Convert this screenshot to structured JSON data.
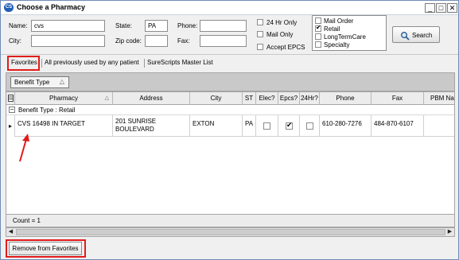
{
  "window": {
    "title": "Choose a Pharmacy",
    "icon_text": "CS",
    "minimize": "_",
    "maximize": "□",
    "close": "✕"
  },
  "search": {
    "name_label": "Name:",
    "name_value": "cvs",
    "city_label": "City:",
    "city_value": "",
    "state_label": "State:",
    "state_value": "PA",
    "zip_label": "Zip code:",
    "zip_value": "",
    "phone_label": "Phone:",
    "phone_value": "",
    "fax_label": "Fax:",
    "fax_value": "",
    "options": [
      {
        "label": "24 Hr Only",
        "checked": false
      },
      {
        "label": "Mail Only",
        "checked": false
      },
      {
        "label": "Accept EPCS",
        "checked": false
      }
    ],
    "types": [
      {
        "label": "Mail Order",
        "checked": false
      },
      {
        "label": "Retail",
        "checked": true
      },
      {
        "label": "LongTermCare",
        "checked": false
      },
      {
        "label": "Specialty",
        "checked": false
      }
    ],
    "search_button": "Search"
  },
  "tabs": [
    "Favorites",
    "All previously used by any patient",
    "SureScripts Master List"
  ],
  "groupby": {
    "chip": "Benefit Type"
  },
  "grid": {
    "columns": [
      "Pharmacy",
      "Address",
      "City",
      "ST",
      "Elec?",
      "Epcs?",
      "24Hr?",
      "Phone",
      "Fax",
      "PBM Nam"
    ],
    "group_label": "Benefit Type : Retail",
    "rows": [
      {
        "pharmacy": "CVS 16498 IN TARGET",
        "address_1": "201 SUNRISE",
        "address_2": "BOULEVARD",
        "city": "EXTON",
        "st": "PA",
        "elec": false,
        "epcs": true,
        "hr24": false,
        "phone": "610-280-7276",
        "fax": "484-870-6107",
        "pbm": ""
      }
    ]
  },
  "count_text": "Count = 1",
  "remove_button": "Remove from Favorites",
  "colors": {
    "highlight": "#e11b1b",
    "titlebar_icon": "#1f5fb4"
  }
}
